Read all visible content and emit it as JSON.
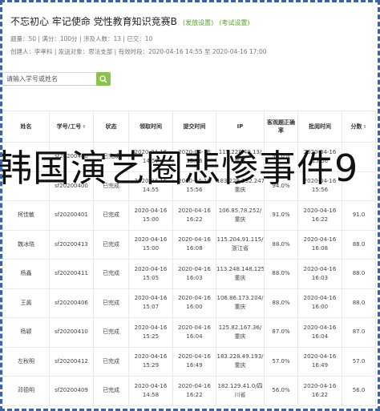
{
  "header": {
    "title": "不忘初心 牢记使命 党性教育知识竞赛B",
    "link_publish": "(发放设置)",
    "link_exam": "(考试设置)",
    "stats": "题量：50 | 满分：100分 | 涉及人数：13 | 已交：10",
    "info": "创建人：李孝科 | 发送对象：思法支部 | 有效时段：2020-04-16 14:55 至 2020-04-16 17:00"
  },
  "search": {
    "placeholder": "请输入学号或姓名"
  },
  "overlay": {
    "text": "韩国演艺圈悲惨事件9"
  },
  "table": {
    "headers": {
      "name": "姓名",
      "id": "学号/工号",
      "status": "状态",
      "start": "领取时间",
      "submit": "提交时间",
      "ip": "IP",
      "rate": "客观题正确率",
      "review": "批阅时间",
      "score": "分数"
    },
    "rows": [
      {
        "name": "",
        "id": "sf20200400",
        "status": "已完成",
        "start": "2020-04-16 14:57",
        "submit": "2020-04-16 15:56",
        "ip": "115.228.49.13/重庆",
        "rate": "94.0%",
        "review": "2020-04-16 15:56",
        "score": ""
      },
      {
        "name": "",
        "id": "sf20200400",
        "status": "已完成",
        "start": "2020-04-16 14:55",
        "submit": "2020-04-16 15:56",
        "ip": "183.228.232.247/重庆",
        "rate": "94.0%",
        "review": "2020-04-16 15:56",
        "score": ""
      },
      {
        "name": "柯佳敏",
        "id": "sf20200401",
        "status": "已完成",
        "start": "2020-04-16 15:00",
        "submit": "2020-04-16 16:22",
        "ip": "106.85.78.252/重庆",
        "rate": "91.0%",
        "review": "2020-04-16 16:22",
        "score": "91.0"
      },
      {
        "name": "魏冰晓",
        "id": "sf20200413",
        "status": "已完成",
        "start": "2020-04-16 15:00",
        "submit": "2020-04-16 16:08",
        "ip": "115.204.91.115/浙江省",
        "rate": "88.0%",
        "review": "2020-04-16 16:08",
        "score": "88.0"
      },
      {
        "name": "杨鑫",
        "id": "sf20200411",
        "status": "已完成",
        "start": "2020-04-16 15:05",
        "submit": "2020-04-16 16:03",
        "ip": "113.248.148.125/重庆",
        "rate": "88.0%",
        "review": "2020-04-16 16:03",
        "score": "88.0"
      },
      {
        "name": "王酱",
        "id": "sf20200406",
        "status": "已完成",
        "start": "2020-04-16 15:07",
        "submit": "2020-04-16 16:00",
        "ip": "106.86.173.204/重庆",
        "rate": "88.0%",
        "review": "2020-04-16 16:00",
        "score": "88.0"
      },
      {
        "name": "杨颖",
        "id": "sf20200410",
        "status": "已完成",
        "start": "2020-04-16 15:25",
        "submit": "2020-04-16 16:04",
        "ip": "125.82.167.36/重庆",
        "rate": "87.0%",
        "review": "2020-04-16 16:04",
        "score": "87.0"
      },
      {
        "name": "左秋明",
        "id": "sf20200412",
        "status": "已完成",
        "start": "2020-04-16 15:29",
        "submit": "2020-04-16 16:49",
        "ip": "183.228.49.193/重庆",
        "rate": "57.0%",
        "review": "2020-04-16 16:49",
        "score": "57.0"
      },
      {
        "name": "邓德明",
        "id": "sf20200409",
        "status": "已完成",
        "start": "2020-04-16 14:58",
        "submit": "2020-04-16 16:22",
        "ip": "182.129.41.0/四川省",
        "rate": "56.0%",
        "review": "2020-04-16 16:22",
        "score": "56.0"
      }
    ]
  }
}
